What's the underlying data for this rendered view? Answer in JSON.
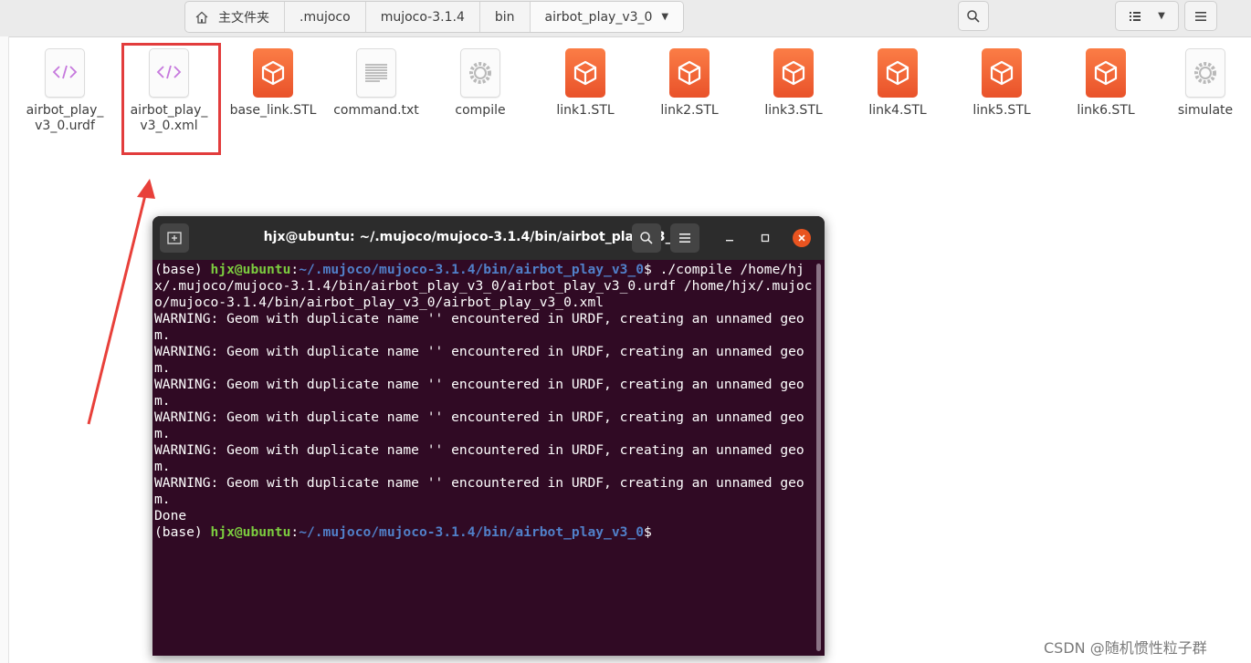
{
  "breadcrumb": {
    "home_label": "主文件夹",
    "items": [
      ".mujoco",
      "mujoco-3.1.4",
      "bin",
      "airbot_play_v3_0"
    ]
  },
  "files": [
    {
      "name_line1": "airbot_play_",
      "name_line2": "v3_0.urdf",
      "kind": "code"
    },
    {
      "name_line1": "airbot_play_",
      "name_line2": "v3_0.xml",
      "kind": "code"
    },
    {
      "name_line1": "base_link.STL",
      "name_line2": "",
      "kind": "stl"
    },
    {
      "name_line1": "command.txt",
      "name_line2": "",
      "kind": "text"
    },
    {
      "name_line1": "compile",
      "name_line2": "",
      "kind": "exec"
    },
    {
      "name_line1": "link1.STL",
      "name_line2": "",
      "kind": "stl"
    },
    {
      "name_line1": "link2.STL",
      "name_line2": "",
      "kind": "stl"
    },
    {
      "name_line1": "link3.STL",
      "name_line2": "",
      "kind": "stl"
    },
    {
      "name_line1": "link4.STL",
      "name_line2": "",
      "kind": "stl"
    },
    {
      "name_line1": "link5.STL",
      "name_line2": "",
      "kind": "stl"
    },
    {
      "name_line1": "link6.STL",
      "name_line2": "",
      "kind": "stl"
    },
    {
      "name_line1": "simulate",
      "name_line2": "",
      "kind": "exec"
    }
  ],
  "terminal": {
    "title": "hjx@ubuntu: ~/.mujoco/mujoco-3.1.4/bin/airbot_play_v3_0",
    "prompt_env": "(base) ",
    "prompt_user": "hjx@ubuntu",
    "prompt_colon": ":",
    "prompt_path": "~/.mujoco/mujoco-3.1.4/bin/airbot_play_v3_0",
    "prompt_dollar": "$",
    "command": " ./compile /home/hjx/.mujoco/mujoco-3.1.4/bin/airbot_play_v3_0/airbot_play_v3_0.urdf /home/hjx/.mujoco/mujoco-3.1.4/bin/airbot_play_v3_0/airbot_play_v3_0.xml",
    "output_lines": [
      "WARNING: Geom with duplicate name '' encountered in URDF, creating an unnamed geom.",
      "WARNING: Geom with duplicate name '' encountered in URDF, creating an unnamed geom.",
      "WARNING: Geom with duplicate name '' encountered in URDF, creating an unnamed geom.",
      "WARNING: Geom with duplicate name '' encountered in URDF, creating an unnamed geom.",
      "WARNING: Geom with duplicate name '' encountered in URDF, creating an unnamed geom.",
      "WARNING: Geom with duplicate name '' encountered in URDF, creating an unnamed geom.",
      "Done"
    ]
  },
  "watermark": "CSDN @随机惯性粒子群",
  "colors": {
    "terminal_bg": "#300a24",
    "prompt_user": "#7ccd3f",
    "prompt_path": "#5180c9",
    "highlight_red": "#e23c3c",
    "stl_orange": "#f26b3a",
    "code_purple": "#c678dd"
  },
  "icons": {
    "home": "home-icon",
    "search": "search-icon",
    "list_view": "list-view-icon",
    "dropdown": "chevron-down-icon",
    "menu": "hamburger-menu-icon",
    "new_tab": "new-tab-icon",
    "minimize": "minimize-icon",
    "maximize": "maximize-icon",
    "close": "close-icon"
  }
}
